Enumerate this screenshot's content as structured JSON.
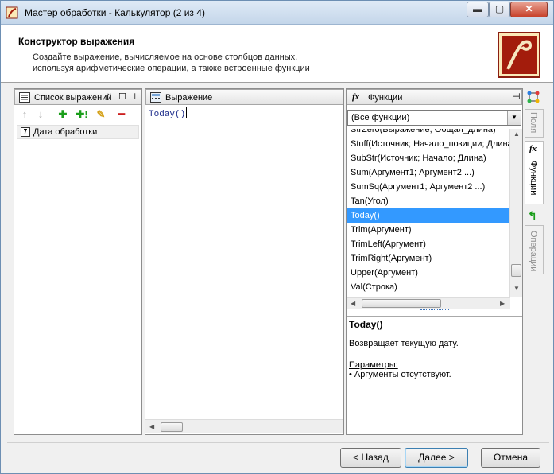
{
  "window": {
    "title": "Мастер обработки - Калькулятор (2 из 4)",
    "minimize_glyph": "▬",
    "maximize_glyph": "▢",
    "close_glyph": "✕"
  },
  "header": {
    "title": "Конструктор выражения",
    "description_line1": "Создайте выражение, вычисляемое на основе столбцов данных,",
    "description_line2": "используя арифметические операции, а также встроенные функции"
  },
  "left_panel": {
    "title": "Список выражений",
    "items": [
      {
        "icon_text": "7",
        "label": "Дата обработки"
      }
    ]
  },
  "expression_panel": {
    "title": "Выражение",
    "code": "Today()"
  },
  "functions_panel": {
    "title": "Функции",
    "filter_selected": "(Все функции)",
    "items": [
      "StrZero(Выражение; Общая_длина)",
      "Stuff(Источник; Начало_позиции; Длина",
      "SubStr(Источник; Начало; Длина)",
      "Sum(Аргумент1; Аргумент2 ...)",
      "SumSq(Аргумент1; Аргумент2 ...)",
      "Tan(Угол)",
      "Today()",
      "Trim(Аргумент)",
      "TrimLeft(Аргумент)",
      "TrimRight(Аргумент)",
      "Upper(Аргумент)",
      "Val(Строка)"
    ],
    "selected_index": 6,
    "description": {
      "title": "Today()",
      "text": "Возвращает текущую дату.",
      "params_label": "Параметры:",
      "bullet": "•  Аргументы отсутствуют."
    }
  },
  "side_tabs": [
    {
      "label": "Поля"
    },
    {
      "label": "Функции"
    },
    {
      "label": "Операции"
    }
  ],
  "footer": {
    "back_label": "< Назад",
    "next_label": "Далее >",
    "cancel_label": "Отмена"
  },
  "colors": {
    "selection": "#3399ff",
    "logo_red": "#a31c0c"
  }
}
